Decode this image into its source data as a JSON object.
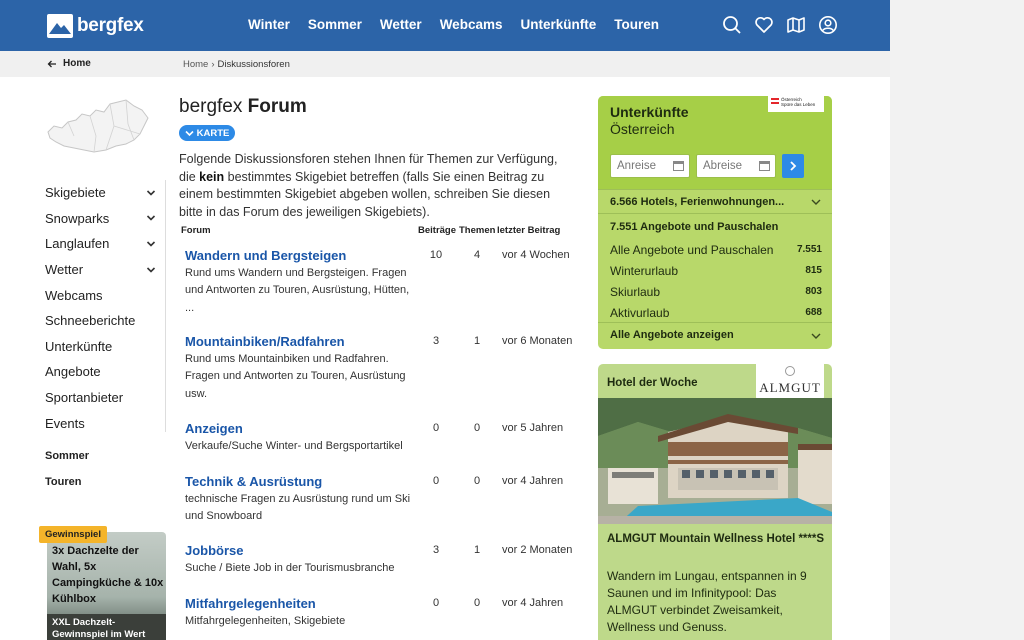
{
  "header": {
    "logo_text": "bergfex",
    "nav": [
      "Winter",
      "Sommer",
      "Wetter",
      "Webcams",
      "Unterkünfte",
      "Touren"
    ],
    "icons": [
      "search-icon",
      "heart-icon",
      "map-icon",
      "user-icon"
    ]
  },
  "breadcrumb": {
    "home_label": "Home",
    "items": [
      "Home",
      "Diskussionsforen"
    ]
  },
  "sidebar": {
    "items": [
      {
        "label": "Skigebiete",
        "expandable": true
      },
      {
        "label": "Snowparks",
        "expandable": true
      },
      {
        "label": "Langlaufen",
        "expandable": true
      },
      {
        "label": "Wetter",
        "expandable": true
      },
      {
        "label": "Webcams",
        "expandable": false
      },
      {
        "label": "Schneeberichte",
        "expandable": false
      },
      {
        "label": "Unterkünfte",
        "expandable": false
      },
      {
        "label": "Angebote",
        "expandable": false
      },
      {
        "label": "Sportanbieter",
        "expandable": false
      },
      {
        "label": "Events",
        "expandable": false
      }
    ],
    "sommer": "Sommer",
    "touren": "Touren"
  },
  "promo": {
    "badge": "Gewinnspiel",
    "title": "3x Dachzelte der Wahl, 5x Campingküche & 10x Kühlbox",
    "footer": "XXL Dachzelt-Gewinnspiel im Wert von"
  },
  "main": {
    "title_light": "bergfex",
    "title_bold": "Forum",
    "karte_label": "KARTE",
    "intro_pre": "Folgende Diskussionsforen stehen Ihnen für Themen zur Verfügung, die ",
    "intro_bold": "kein",
    "intro_post": " bestimmtes Skigebiet betreffen (falls Sie einen Beitrag zu einem bestimmten Skigebiet abgeben wollen, schreiben Sie diesen bitte in das Forum des jeweiligen Skigebiets).",
    "columns": {
      "forum": "Forum",
      "posts": "Beiträge",
      "topics": "Themen",
      "last": "letzter Beitrag"
    },
    "forums": [
      {
        "name": "Wandern und Bergsteigen",
        "desc": "Rund ums Wandern und Bergsteigen. Fragen und Antworten zu Touren, Ausrüstung, Hütten, ...",
        "posts": "10",
        "topics": "4",
        "last": "vor 4 Wochen"
      },
      {
        "name": "Mountainbiken/Radfahren",
        "desc": "Rund ums Mountainbiken und Radfahren. Fragen und Antworten zu Touren, Ausrüstung usw.",
        "posts": "3",
        "topics": "1",
        "last": "vor 6 Monaten"
      },
      {
        "name": "Anzeigen",
        "desc": "Verkaufe/Suche Winter- und Bergsportartikel",
        "posts": "0",
        "topics": "0",
        "last": "vor 5 Jahren"
      },
      {
        "name": "Technik & Ausrüstung",
        "desc": "technische Fragen zu Ausrüstung rund um Ski und Snowboard",
        "posts": "0",
        "topics": "0",
        "last": "vor 4 Jahren"
      },
      {
        "name": "Jobbörse",
        "desc": "Suche / Biete Job in der Tourismusbranche",
        "posts": "3",
        "topics": "1",
        "last": "vor 2 Monaten"
      },
      {
        "name": "Mitfahrgelegenheiten",
        "desc": "Mitfahrgelegenheiten, Skigebiete",
        "posts": "0",
        "topics": "0",
        "last": "vor 4 Jahren"
      }
    ]
  },
  "accommodation": {
    "title": "Unterkünfte",
    "subtitle": "Österreich",
    "badge_line1": "Österreich",
    "badge_line2": "Spüre das Leben",
    "arrival_placeholder": "Anreise",
    "departure_placeholder": "Abreise",
    "hotels_link": "6.566 Hotels, Ferienwohnungen...",
    "offers_heading": "7.551 Angebote und Pauschalen",
    "offers": [
      {
        "label": "Alle Angebote und Pauschalen",
        "count": "7.551"
      },
      {
        "label": "Winterurlaub",
        "count": "815"
      },
      {
        "label": "Skiurlaub",
        "count": "803"
      },
      {
        "label": "Aktivurlaub",
        "count": "688"
      }
    ],
    "all_offers": "Alle Angebote anzeigen"
  },
  "hotel_of_week": {
    "label": "Hotel der Woche",
    "logo": "ALMGUT",
    "name": "ALMGUT Mountain Wellness Hotel ****S",
    "description": "Wandern im Lungau, entspannen in 9 Saunen und im Infinitypool: Das ALMGUT verbindet Zweisamkeit, Wellness und Genuss."
  },
  "colors": {
    "header_blue": "#2c64a8",
    "link_blue": "#1a56a8",
    "button_blue": "#2d8ae6",
    "accommodation_green": "#b8d86a",
    "promo_yellow": "#f4b42a"
  }
}
